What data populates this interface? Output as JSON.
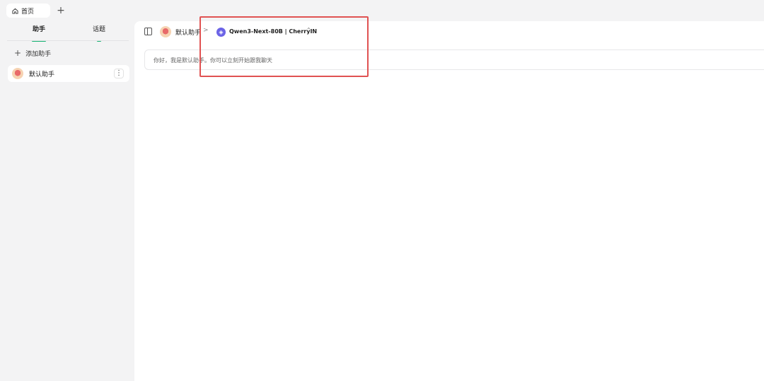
{
  "tabbar": {
    "home_tab_label": "首页",
    "add_tab_label": "+"
  },
  "sidebar": {
    "tabs": [
      {
        "label": "助手",
        "active": true
      },
      {
        "label": "话题",
        "active": false
      }
    ],
    "add_assistant_label": "添加助手",
    "assistants": [
      {
        "name": "默认助手"
      }
    ]
  },
  "header": {
    "assistant_name": "默认助手",
    "model_name": "Qwen3-Next-80B | CherryIN"
  },
  "chat": {
    "welcome_message": "你好，我是默认助手。你可以立刻开始跟我聊天"
  },
  "colors": {
    "accent": "#15b372",
    "highlight": "#e05252",
    "model_icon": "#6b63e6"
  }
}
